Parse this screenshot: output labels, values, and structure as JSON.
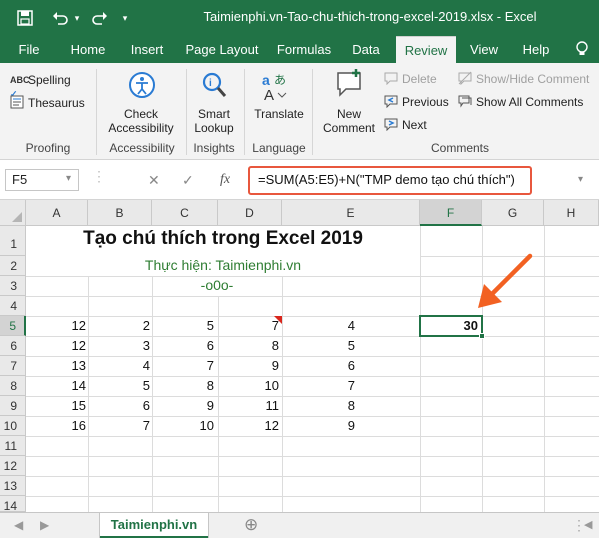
{
  "window": {
    "title": "Taimienphi.vn-Tao-chu-thich-trong-excel-2019.xlsx  -  Excel",
    "accent": "#217346"
  },
  "tabs": [
    {
      "label": "File"
    },
    {
      "label": "Home"
    },
    {
      "label": "Insert"
    },
    {
      "label": "Page Layout"
    },
    {
      "label": "Formulas"
    },
    {
      "label": "Data"
    },
    {
      "label": "Review"
    },
    {
      "label": "View"
    },
    {
      "label": "Help"
    }
  ],
  "ribbon": {
    "spelling": "Spelling",
    "thesaurus": "Thesaurus",
    "proofing": "Proofing",
    "check_accessibility": [
      "Check",
      "Accessibility"
    ],
    "accessibility": "Accessibility",
    "smart_lookup": [
      "Smart",
      "Lookup"
    ],
    "insights": "Insights",
    "translate": "Translate",
    "language": "Language",
    "new_comment": [
      "New",
      "Comment"
    ],
    "delete": "Delete",
    "previous": "Previous",
    "next": "Next",
    "show_hide_comment": "Show/Hide Comment",
    "show_all_comments": "Show All Comments",
    "comments": "Comments"
  },
  "formula_bar": {
    "name_box": "F5",
    "fx": "fx",
    "formula": "=SUM(A5:E5)+N(\"TMP demo tạo chú thích\")",
    "highlight_color": "#e8573d"
  },
  "grid": {
    "columns": [
      "A",
      "B",
      "C",
      "D",
      "E",
      "F",
      "G",
      "H"
    ],
    "rows": [
      "1",
      "2",
      "3",
      "4",
      "5",
      "6",
      "7",
      "8",
      "9",
      "10",
      "11",
      "12",
      "13",
      "14"
    ],
    "title": "Tạo chú thích trong Excel 2019",
    "subtitle": "Thực hiện: Taimienphi.vn",
    "separator": "-o0o-",
    "subtitle_color": "#2e7d32",
    "data_rows": [
      [
        "12",
        "2",
        "5",
        "7",
        "4"
      ],
      [
        "12",
        "3",
        "6",
        "8",
        "5"
      ],
      [
        "13",
        "4",
        "7",
        "9",
        "6"
      ],
      [
        "14",
        "5",
        "8",
        "10",
        "7"
      ],
      [
        "15",
        "6",
        "9",
        "11",
        "8"
      ],
      [
        "16",
        "7",
        "10",
        "12",
        "9"
      ]
    ],
    "selected_value": "30",
    "selected_cell": "F5"
  },
  "sheet": {
    "name": "Taimienphi.vn",
    "add": "⊕"
  }
}
